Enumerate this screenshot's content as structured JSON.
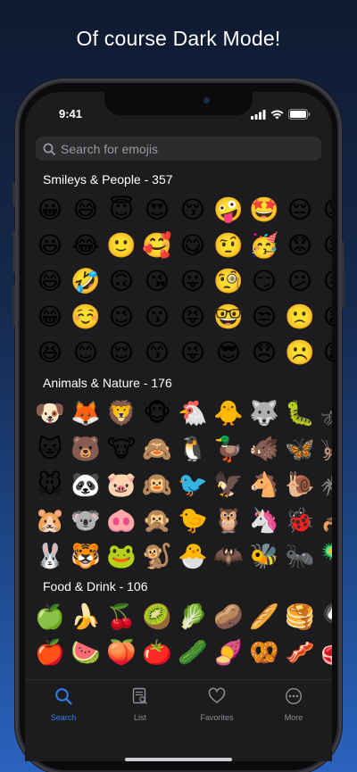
{
  "headline": "Of course Dark Mode!",
  "status": {
    "time": "9:41"
  },
  "search": {
    "placeholder": "Search for emojis"
  },
  "sections": [
    {
      "title": "Smileys & People - 357",
      "rows": [
        [
          "😀",
          "😅",
          "😇",
          "😍",
          "😚",
          "🤪",
          "🤩",
          "😔",
          "😟"
        ],
        [
          "😃",
          "😂",
          "🙂",
          "🥰",
          "😋",
          "🤨",
          "🥳",
          "😟",
          "😣"
        ],
        [
          "😄",
          "🤣",
          "🙃",
          "😘",
          "😛",
          "🧐",
          "😏",
          "😕",
          "😖"
        ],
        [
          "😁",
          "☺️",
          "😉",
          "😗",
          "😝",
          "🤓",
          "😒",
          "🙁",
          "😫"
        ],
        [
          "😆",
          "😊",
          "😌",
          "😙",
          "😜",
          "😎",
          "😞",
          "☹️",
          "😩"
        ]
      ]
    },
    {
      "title": "Animals & Nature - 176",
      "rows": [
        [
          "🐶",
          "🦊",
          "🦁",
          "🐵",
          "🐔",
          "🐥",
          "🐺",
          "🐛",
          "🦟"
        ],
        [
          "🐱",
          "🐻",
          "🐮",
          "🙈",
          "🐧",
          "🦆",
          "🐗",
          "🦋",
          "🦗"
        ],
        [
          "🐭",
          "🐼",
          "🐷",
          "🙉",
          "🐦",
          "🦅",
          "🐴",
          "🐌",
          "🕷️"
        ],
        [
          "🐹",
          "🐨",
          "🐽",
          "🙊",
          "🐤",
          "🦉",
          "🦄",
          "🐞",
          "🦂"
        ],
        [
          "🐰",
          "🐯",
          "🐸",
          "🐒",
          "🐣",
          "🦇",
          "🐝",
          "🐜",
          "🦠"
        ]
      ]
    },
    {
      "title": "Food & Drink - 106",
      "rows": [
        [
          "🍏",
          "🍌",
          "🍒",
          "🥝",
          "🥬",
          "🥔",
          "🥖",
          "🥞",
          "🍳"
        ],
        [
          "🍎",
          "🍉",
          "🍑",
          "🍅",
          "🥒",
          "🍠",
          "🥨",
          "🥓",
          "🥩"
        ]
      ]
    }
  ],
  "tabs": [
    {
      "label": "Search",
      "icon": "magnifier-icon",
      "active": true
    },
    {
      "label": "List",
      "icon": "list-icon",
      "active": false
    },
    {
      "label": "Favorites",
      "icon": "heart-icon",
      "active": false
    },
    {
      "label": "More",
      "icon": "ellipsis-icon",
      "active": false
    }
  ],
  "colors": {
    "accent": "#2f80ed",
    "inactive": "#8e8e93",
    "surface": "#1c1c1e"
  }
}
